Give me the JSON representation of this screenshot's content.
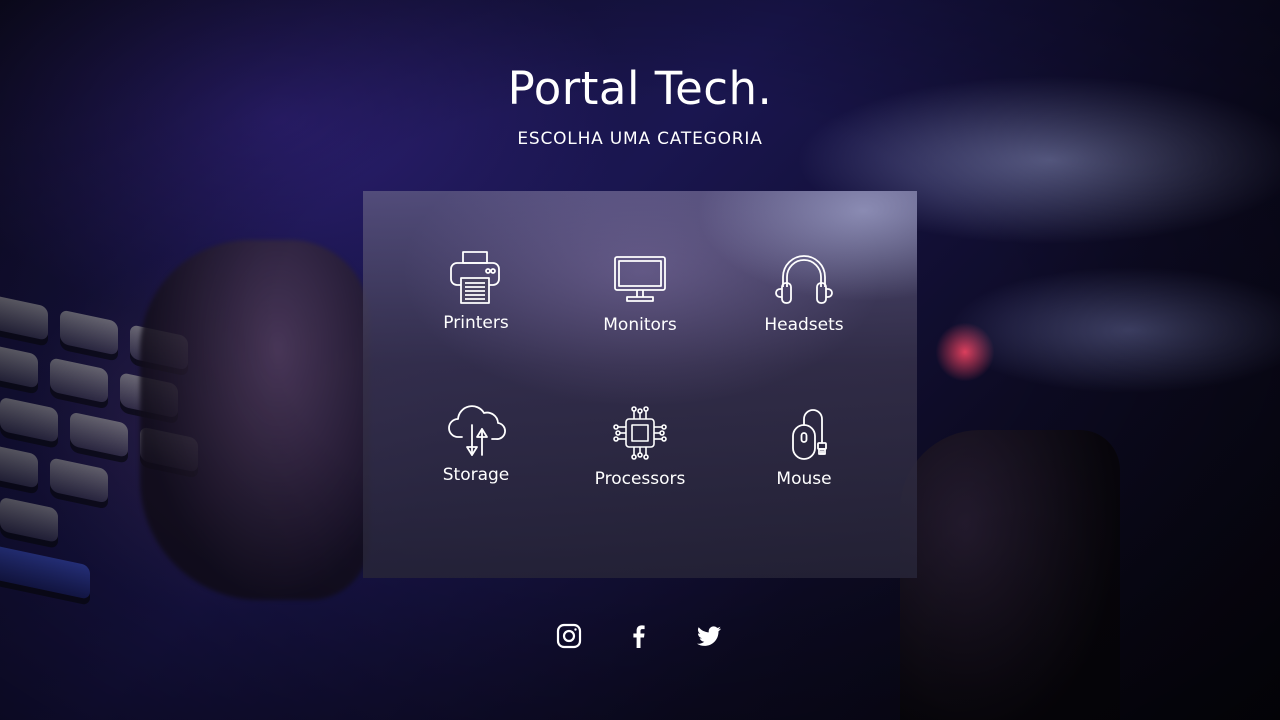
{
  "header": {
    "title": "Portal Tech.",
    "subtitle": "ESCOLHA UMA CATEGORIA"
  },
  "categories": [
    {
      "label": "Printers",
      "icon": "printer-icon"
    },
    {
      "label": "Monitors",
      "icon": "monitor-icon"
    },
    {
      "label": "Headsets",
      "icon": "headset-icon"
    },
    {
      "label": "Storage",
      "icon": "cloud-storage-icon"
    },
    {
      "label": "Processors",
      "icon": "processor-icon"
    },
    {
      "label": "Mouse",
      "icon": "mouse-icon"
    }
  ],
  "social": [
    {
      "icon": "instagram-icon"
    },
    {
      "icon": "facebook-icon"
    },
    {
      "icon": "twitter-icon"
    }
  ],
  "colors": {
    "text": "#ffffff",
    "panel": "#3a3650",
    "background": "#120f2e"
  }
}
